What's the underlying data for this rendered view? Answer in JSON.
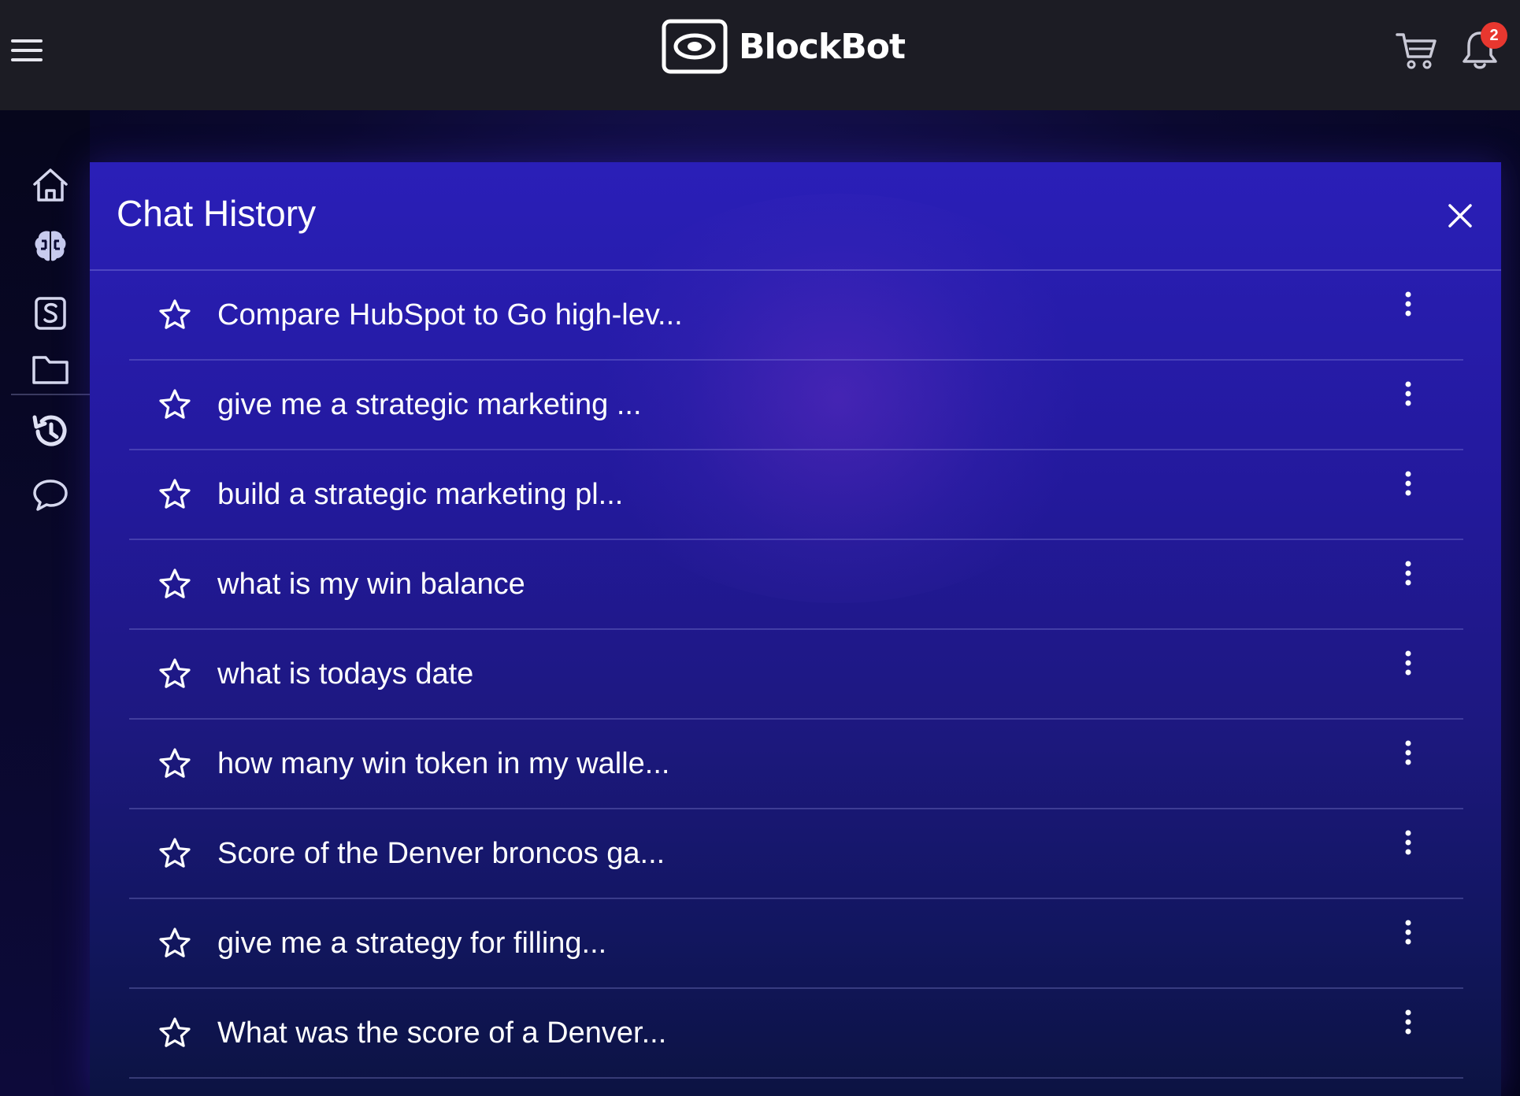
{
  "header": {
    "brand": "BlockBot",
    "notification_count": "2"
  },
  "sidebar": {
    "items": [
      {
        "icon": "home-icon"
      },
      {
        "icon": "brain-icon"
      },
      {
        "icon": "dollar-icon"
      },
      {
        "icon": "folder-icon"
      },
      {
        "icon": "history-icon"
      },
      {
        "icon": "chat-bubble-icon"
      }
    ]
  },
  "panel": {
    "title": "Chat History",
    "items": [
      {
        "label": "Compare HubSpot to Go high-lev..."
      },
      {
        "label": "give me a strategic marketing ..."
      },
      {
        "label": "build a strategic marketing pl..."
      },
      {
        "label": "what is my win balance"
      },
      {
        "label": "what is todays date"
      },
      {
        "label": "how many win token in my walle..."
      },
      {
        "label": "Score of the Denver broncos ga..."
      },
      {
        "label": "give me a strategy for filling..."
      },
      {
        "label": "What was the score of a Denver..."
      }
    ]
  },
  "colors": {
    "topbar": "#1c1c24",
    "panel_top": "#2a1fb8",
    "panel_bottom": "#0c1342",
    "badge": "#e8372f"
  }
}
